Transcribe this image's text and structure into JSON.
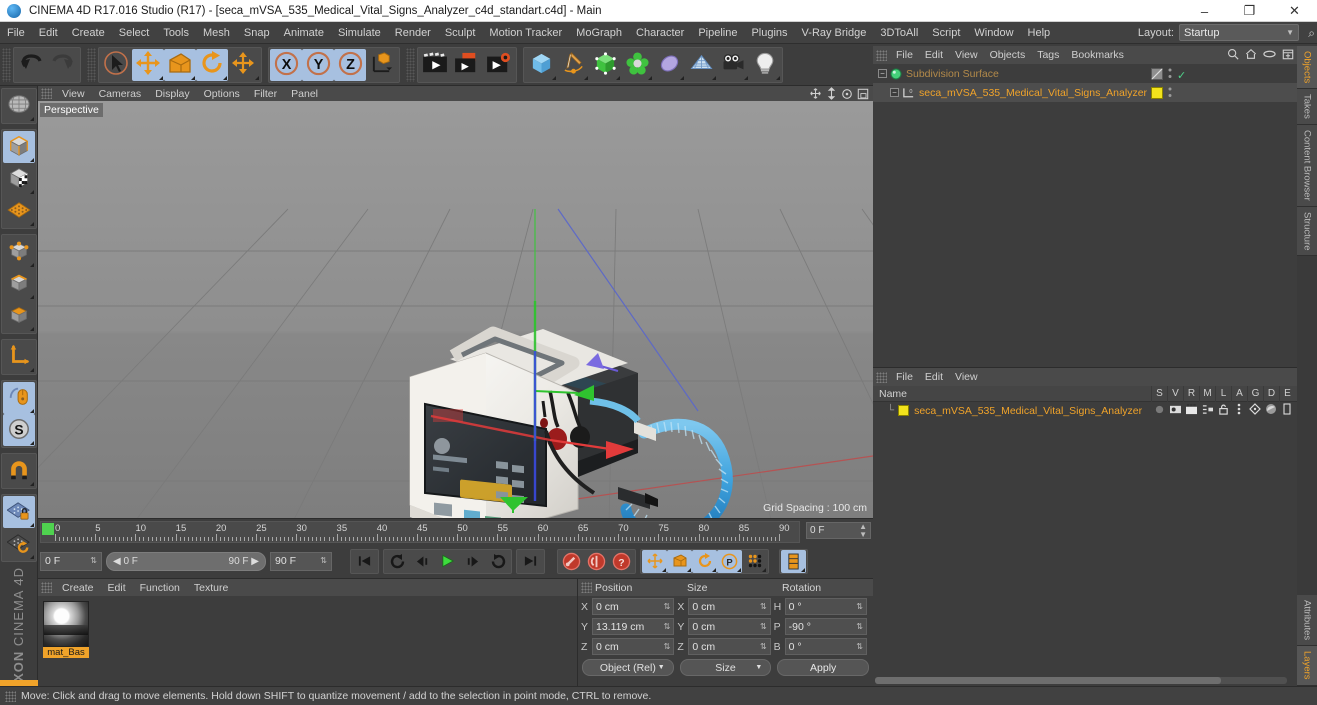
{
  "window": {
    "title": "CINEMA 4D R17.016 Studio (R17) - [seca_mVSA_535_Medical_Vital_Signs_Analyzer_c4d_standart.c4d] - Main",
    "minimize": "–",
    "maximize": "❐",
    "close": "✕"
  },
  "menubar": {
    "items": [
      "File",
      "Edit",
      "Create",
      "Select",
      "Tools",
      "Mesh",
      "Snap",
      "Animate",
      "Simulate",
      "Render",
      "Sculpt",
      "Motion Tracker",
      "MoGraph",
      "Character",
      "Pipeline",
      "Plugins",
      "V-Ray Bridge",
      "3DToAll",
      "Script",
      "Window",
      "Help"
    ],
    "layout_label": "Layout:",
    "layout_value": "Startup",
    "layout_arrow": "▼",
    "search_icon": "⌕"
  },
  "toolbar": {
    "groups": [
      {
        "name": "history",
        "buttons": [
          {
            "icon": "undo-icon",
            "selected": false
          },
          {
            "icon": "redo-icon",
            "selected": false
          }
        ]
      },
      {
        "name": "transform",
        "buttons": [
          {
            "icon": "live-selection-icon",
            "selected": false
          },
          {
            "icon": "move-icon",
            "selected": true
          },
          {
            "icon": "scale-icon",
            "selected": true
          },
          {
            "icon": "rotate-icon",
            "selected": true
          },
          {
            "icon": "move-alt-icon",
            "selected": false
          }
        ]
      },
      {
        "name": "axis-locks",
        "buttons": [
          {
            "icon": "x-axis-icon",
            "selected": true
          },
          {
            "icon": "y-axis-icon",
            "selected": true
          },
          {
            "icon": "z-axis-icon",
            "selected": true
          },
          {
            "icon": "world-object-axis-icon",
            "selected": false
          }
        ]
      },
      {
        "name": "render",
        "buttons": [
          {
            "icon": "render-view-icon",
            "selected": false
          },
          {
            "icon": "render-to-picture-viewer-icon",
            "selected": false
          },
          {
            "icon": "render-settings-icon",
            "selected": false
          }
        ]
      },
      {
        "name": "create",
        "buttons": [
          {
            "icon": "cube-primitive-icon",
            "selected": false
          },
          {
            "icon": "spline-pen-icon",
            "selected": false
          },
          {
            "icon": "generator-icon",
            "selected": false
          },
          {
            "icon": "deformer-icon",
            "selected": false
          },
          {
            "icon": "environment-icon",
            "selected": false
          },
          {
            "icon": "floor-scene-icon",
            "selected": false
          },
          {
            "icon": "camera-icon",
            "selected": false
          },
          {
            "icon": "light-icon",
            "selected": false
          }
        ]
      }
    ]
  },
  "left_toolbar": {
    "groups": [
      {
        "buttons": [
          {
            "icon": "viewport-globe-icon",
            "selected": false
          }
        ]
      },
      {
        "buttons": [
          {
            "icon": "model-mode-icon",
            "selected": true
          },
          {
            "icon": "texture-mode-icon",
            "selected": false
          },
          {
            "icon": "polygon-grid-icon",
            "selected": false
          }
        ]
      },
      {
        "buttons": [
          {
            "icon": "point-mode-icon",
            "selected": false
          },
          {
            "icon": "edge-mode-icon",
            "selected": false
          },
          {
            "icon": "polygon-mode-icon",
            "selected": false
          }
        ]
      },
      {
        "buttons": [
          {
            "icon": "axis-modify-icon",
            "selected": false
          }
        ]
      },
      {
        "buttons": [
          {
            "icon": "enable-axis-icon",
            "selected": true
          },
          {
            "icon": "s-object-icon",
            "selected": true
          }
        ]
      },
      {
        "buttons": [
          {
            "icon": "magnet-icon",
            "selected": false
          }
        ]
      },
      {
        "buttons": [
          {
            "icon": "lock-workplane-icon",
            "selected": true
          },
          {
            "icon": "workplane-rotate-icon",
            "selected": false
          }
        ]
      }
    ],
    "logo_top": "MAXON",
    "logo_bottom": "CINEMA 4D"
  },
  "viewport": {
    "menu": [
      "View",
      "Cameras",
      "Display",
      "Options",
      "Filter",
      "Panel"
    ],
    "label": "Perspective",
    "grid_spacing": "Grid Spacing : 100 cm",
    "nav_icons": [
      "pan-icon",
      "zoom-icon",
      "rotate-view-icon",
      "maximize-view-icon"
    ]
  },
  "timeline": {
    "ticks": [
      "0",
      "5",
      "10",
      "15",
      "20",
      "25",
      "30",
      "35",
      "40",
      "45",
      "50",
      "55",
      "60",
      "65",
      "70",
      "75",
      "80",
      "85",
      "90"
    ],
    "current_frame_display": "0 F",
    "start_field": "0 F",
    "slider_left": "0 F",
    "slider_right": "90 F",
    "end_field": "90 F",
    "transport": [
      {
        "icon": "go-to-start-icon"
      },
      {
        "icon": "play-backwards-loop-icon"
      },
      {
        "icon": "step-back-icon"
      },
      {
        "icon": "play-icon"
      },
      {
        "icon": "step-forward-icon"
      },
      {
        "icon": "loop-icon"
      },
      {
        "icon": "go-to-end-icon"
      }
    ],
    "record_group": [
      {
        "icon": "record-keyframe-icon"
      },
      {
        "icon": "autokeying-icon"
      },
      {
        "icon": "keyframe-selection-icon"
      }
    ],
    "key_group": [
      {
        "icon": "position-key-icon",
        "selected": true
      },
      {
        "icon": "scale-key-icon",
        "selected": true
      },
      {
        "icon": "rotation-key-icon",
        "selected": true
      },
      {
        "icon": "parameter-key-icon",
        "selected": true
      },
      {
        "icon": "point-level-animation-icon",
        "selected": false
      }
    ],
    "extra": [
      {
        "icon": "timeline-view-icon",
        "selected": true
      }
    ]
  },
  "material_manager": {
    "menu": [
      "Create",
      "Edit",
      "Function",
      "Texture"
    ],
    "materials": [
      {
        "label": "mat_Bas",
        "name": "material-thumbnail"
      }
    ]
  },
  "coordinates": {
    "headers": [
      "Position",
      "Size",
      "Rotation"
    ],
    "rows": [
      {
        "pos_axis": "X",
        "pos_value": "0 cm",
        "size_axis": "X",
        "size_value": "0 cm",
        "rot_axis": "H",
        "rot_value": "0 °"
      },
      {
        "pos_axis": "Y",
        "pos_value": "13.119 cm",
        "size_axis": "Y",
        "size_value": "0 cm",
        "rot_axis": "P",
        "rot_value": "-90 °"
      },
      {
        "pos_axis": "Z",
        "pos_value": "0 cm",
        "size_axis": "Z",
        "size_value": "0 cm",
        "rot_axis": "B",
        "rot_value": "0 °"
      }
    ],
    "mode_dropdown": "Object (Rel)",
    "size_dropdown": "Size",
    "apply_label": "Apply"
  },
  "object_manager": {
    "menu": [
      "File",
      "Edit",
      "View",
      "Objects",
      "Tags",
      "Bookmarks"
    ],
    "header_icons": [
      "search-icon",
      "home-icon",
      "link-icon",
      "new-layer-icon"
    ],
    "rows": [
      {
        "name": "Subdivision Surface",
        "indent": 0,
        "color": "#b38a4a",
        "selected": false,
        "icon": "subdivision-surface-icon",
        "check": "✓"
      },
      {
        "name": "seca_mVSA_535_Medical_Vital_Signs_Analyzer",
        "indent": 1,
        "color": "#f0a32a",
        "selected": true,
        "icon": "null-object-icon",
        "check": ""
      }
    ]
  },
  "attributes_manager": {
    "menu": [
      "File",
      "Edit",
      "View"
    ],
    "name_column": "Name",
    "columns": [
      "S",
      "V",
      "R",
      "M",
      "L",
      "A",
      "G",
      "D",
      "E"
    ],
    "rows": [
      {
        "name": "seca_mVSA_535_Medical_Vital_Signs_Analyzer"
      }
    ]
  },
  "vertical_tabs": {
    "top": [
      {
        "label": "Objects",
        "active": true
      },
      {
        "label": "Takes",
        "active": false
      },
      {
        "label": "Content Browser",
        "active": false
      },
      {
        "label": "Structure",
        "active": false
      }
    ],
    "bottom": [
      {
        "label": "Attributes",
        "active": false
      },
      {
        "label": "Layers",
        "active": true
      }
    ]
  },
  "status_bar": {
    "text": "Move: Click and drag to move elements. Hold down SHIFT to quantize movement / add to the selection in point mode, CTRL to remove."
  },
  "colors": {
    "accent": "#f0a32a",
    "selection_blue": "#a7c0e0",
    "panel_bg": "#3d3d3d",
    "header_bg": "#4a4a4a",
    "axis_x": "#d63a3a",
    "axis_y": "#3ec43e",
    "axis_z": "#4a5ad6"
  }
}
